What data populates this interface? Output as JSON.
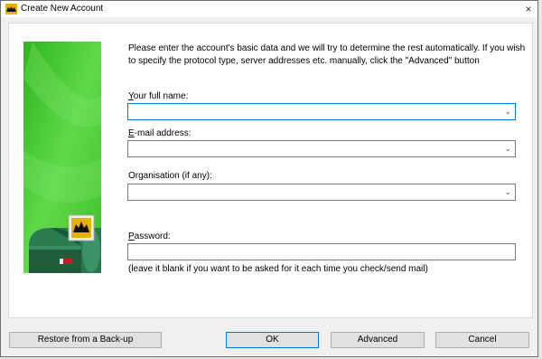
{
  "window": {
    "title": "Create New Account",
    "close_glyph": "×"
  },
  "intro_text": "Please enter the account's basic data and we will try to determine the rest automatically. If you wish to specify the protocol type, server addresses etc. manually, click the \"Advanced\" button",
  "fields": {
    "full_name": {
      "label_accel": "Y",
      "label_rest": "our full name:",
      "value": ""
    },
    "email": {
      "label_accel": "E",
      "label_rest": "-mail address:",
      "value": ""
    },
    "organisation": {
      "label_before": "Or",
      "label_accel": "g",
      "label_rest": "anisation (if any):",
      "value": ""
    },
    "password": {
      "label_accel": "P",
      "label_rest": "assword:",
      "value": ""
    }
  },
  "password_hint": "(leave it blank if you want to be asked for it each time you check/send mail)",
  "buttons": {
    "restore": "Restore from a Back-up",
    "ok": "OK",
    "advanced": "Advanced",
    "cancel": "Cancel"
  },
  "icons": {
    "app": "batmail-app-icon",
    "mailbox": "mailbox-illustration",
    "chevron": "chevron-down-icon",
    "close": "close-icon"
  },
  "colors": {
    "side_panel_green": "#3fc532",
    "focus_blue": "#0078d7",
    "button_face": "#e1e1e1"
  }
}
